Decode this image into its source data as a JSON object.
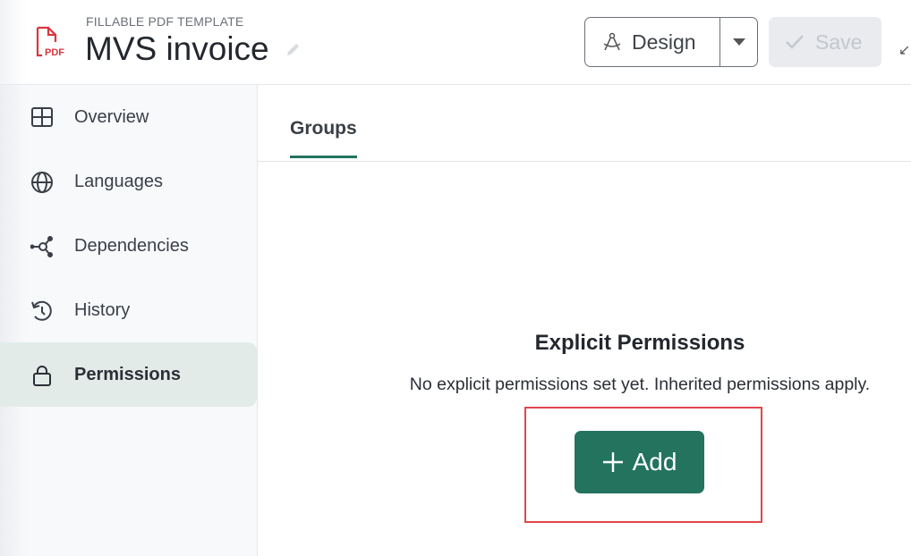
{
  "header": {
    "subtitle": "FILLABLE PDF TEMPLATE",
    "title": "MVS invoice",
    "design_label": "Design",
    "save_label": "Save"
  },
  "sidebar": {
    "items": [
      {
        "label": "Overview",
        "icon": "grid-icon"
      },
      {
        "label": "Languages",
        "icon": "globe-icon"
      },
      {
        "label": "Dependencies",
        "icon": "network-icon"
      },
      {
        "label": "History",
        "icon": "history-icon"
      },
      {
        "label": "Permissions",
        "icon": "lock-icon",
        "active": true
      }
    ]
  },
  "tabs": [
    {
      "label": "Groups",
      "active": true
    }
  ],
  "permissions": {
    "title": "Explicit Permissions",
    "description": "No explicit permissions set yet. Inherited permissions apply.",
    "add_label": "Add"
  },
  "colors": {
    "accent": "#23735f",
    "highlight": "#e0474c",
    "pdf_icon": "#d9363e"
  }
}
